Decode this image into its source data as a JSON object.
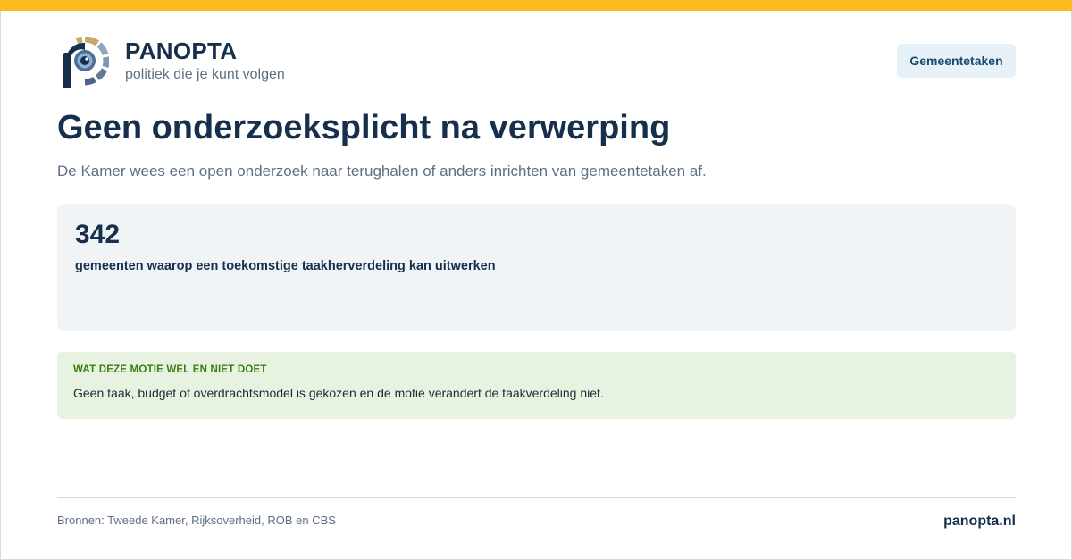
{
  "colors": {
    "accent_bar": "#fbbb1f",
    "brand_navy": "#152f4c",
    "muted_text": "#5e6f82",
    "stat_bg": "#f0f4f7",
    "info_bg": "#e7f2e1",
    "info_heading": "#3b7d11"
  },
  "brand": {
    "logo_icon": "panopta-eye-logo-icon",
    "name": "PANOPTA",
    "tagline": "politiek die je kunt volgen"
  },
  "header": {
    "topic_button": "Gemeentetaken"
  },
  "main": {
    "title": "Geen onderzoeksplicht na verwerping",
    "subtitle": "De Kamer wees een open onderzoek naar terughalen of anders inrichten van gemeentetaken af."
  },
  "stat": {
    "value": "342",
    "label": "gemeenten waarop een toekomstige taakherverdeling kan uitwerken"
  },
  "info": {
    "heading": "WAT DEZE MOTIE WEL EN NIET DOET",
    "text": "Geen taak, budget of overdrachtsmodel is gekozen en de motie verandert de taakverdeling niet."
  },
  "footer": {
    "sources": "Bronnen: Tweede Kamer, Rijksoverheid, ROB en CBS",
    "site": "panopta.nl"
  }
}
